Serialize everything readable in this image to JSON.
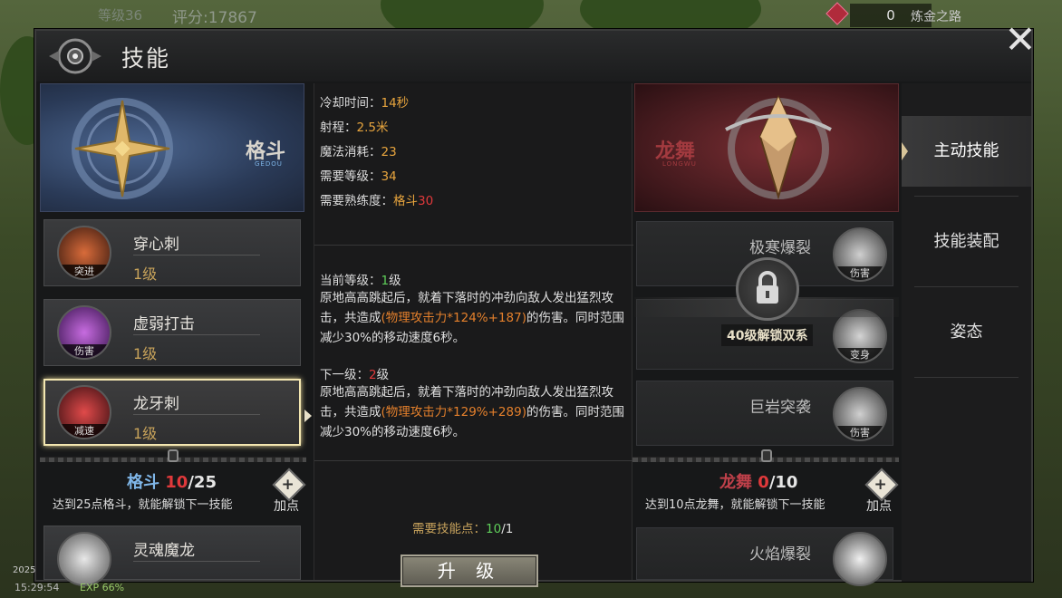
{
  "hud": {
    "rank": "等级36",
    "score": "评分:17867",
    "currency_count": "0",
    "road_label": "炼金之路",
    "time": "15:29:54",
    "exp": "EXP 66%",
    "year_fragment": "2025"
  },
  "window": {
    "title": "技能",
    "close_symbol": "✕"
  },
  "left_school": {
    "name": "格斗",
    "sub": "GEDOU",
    "color": "#7fb6e8"
  },
  "right_school": {
    "name": "龙舞",
    "sub": "LONGWU",
    "color": "#a23a3f"
  },
  "left_skills": [
    {
      "name": "穿心刺",
      "level": "1级",
      "tag": "突进",
      "icon": "piercing-icon"
    },
    {
      "name": "虚弱打击",
      "level": "1级",
      "tag": "伤害",
      "icon": "weakness-icon"
    },
    {
      "name": "龙牙刺",
      "level": "1级",
      "tag": "减速",
      "icon": "dragon-fang-icon"
    },
    {
      "name": "灵魂魔龙",
      "level": "",
      "tag": "",
      "icon": "soul-dragon-icon"
    }
  ],
  "left_points": {
    "school": "格斗",
    "current": "10",
    "max": "/25",
    "desc": "达到25点格斗，就能解锁下一技能",
    "add_label": "加点"
  },
  "right_skills": [
    {
      "name": "极寒爆裂",
      "tag": "伤害",
      "icon": "frost-burst-icon"
    },
    {
      "name": "",
      "tag": "变身",
      "icon": "transform-icon"
    },
    {
      "name": "巨岩突袭",
      "tag": "伤害",
      "icon": "boulder-icon"
    },
    {
      "name": "火焰爆裂",
      "tag": "",
      "icon": "flame-burst-icon"
    }
  ],
  "right_points": {
    "school": "龙舞",
    "current": "0",
    "max": "/10",
    "desc": "达到10点龙舞，就能解锁下一技能",
    "add_label": "加点"
  },
  "lock": {
    "text": "40级解锁双系"
  },
  "detail": {
    "cooldown_label": "冷却时间：",
    "cooldown_value": "14秒",
    "range_label": "射程：",
    "range_value": "2.5米",
    "mana_label": "魔法消耗：",
    "mana_value": "23",
    "req_level_label": "需要等级：",
    "req_level_value": "34",
    "req_prof_label": "需要熟练度：",
    "req_prof_school": "格斗",
    "req_prof_value": "30",
    "current_label": "当前等级：",
    "current_value": "1",
    "current_unit": "级",
    "current_desc_a": "原地高高跳起后，就着下落时的冲劲向敌人发出猛烈攻击，共造成",
    "current_desc_hl": "(物理攻击力*124%+187)",
    "current_desc_b": "的伤害。同时范围减少30%的移动速度6秒。",
    "next_label": "下一级：",
    "next_value": "2",
    "next_unit": "级",
    "next_desc_a": "原地高高跳起后，就着下落时的冲劲向敌人发出猛烈攻击，共造成",
    "next_desc_hl": "(物理攻击力*129%+289)",
    "next_desc_b": "的伤害。同时范围减少30%的移动速度6秒。",
    "need_points_label": "需要技能点：",
    "need_points_value": "10",
    "need_points_max": "/1",
    "upgrade_label": "升 级"
  },
  "sidebar": {
    "items": [
      "主动技能",
      "技能装配",
      "姿态"
    ]
  }
}
